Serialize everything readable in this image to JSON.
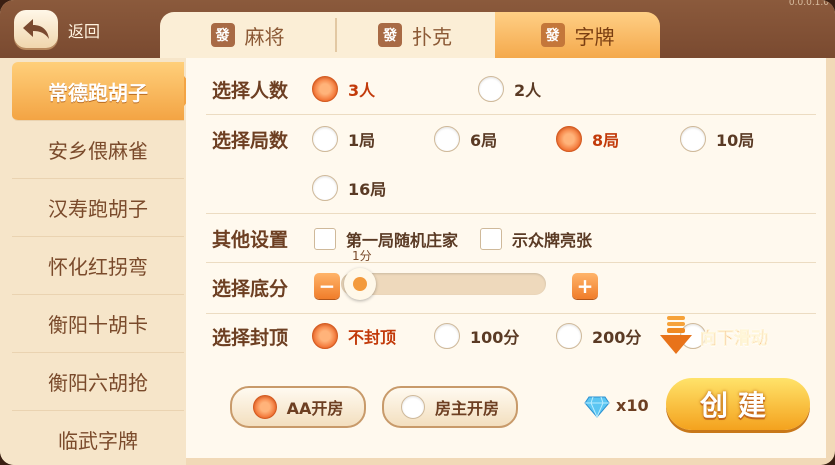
{
  "topbar": {
    "back_label": "返回",
    "version": "0.0.0.1.0"
  },
  "tabs": [
    {
      "icon": "發",
      "label": "麻将"
    },
    {
      "icon": "發",
      "label": "扑克"
    },
    {
      "icon": "發",
      "label": "字牌"
    }
  ],
  "sidebar": {
    "items": [
      "常德跑胡子",
      "安乡偎麻雀",
      "汉寿跑胡子",
      "怀化红拐弯",
      "衡阳十胡卡",
      "衡阳六胡抢",
      "临武字牌"
    ]
  },
  "players": {
    "label": "选择人数",
    "options": [
      "3人",
      "2人"
    ],
    "selected": "3人"
  },
  "rounds": {
    "label": "选择局数",
    "options": [
      "1局",
      "6局",
      "8局",
      "10局",
      "16局"
    ],
    "selected": "8局"
  },
  "other": {
    "label": "其他设置",
    "options": [
      "第一局随机庄家",
      "示众牌亮张"
    ]
  },
  "base": {
    "label": "选择底分",
    "value": "1分",
    "minus": "−",
    "plus": "+"
  },
  "cap": {
    "label": "选择封顶",
    "options": [
      "不封顶",
      "100分",
      "200分"
    ],
    "selected": "不封顶"
  },
  "scroll_hint": "向下滑动",
  "bottom": {
    "aa": "AA开房",
    "host": "房主开房",
    "cost": "x10",
    "create": "创建"
  },
  "colors": {
    "accent": "#f3a444",
    "selected": "#f06a2a",
    "brown": "#7a4a30"
  }
}
